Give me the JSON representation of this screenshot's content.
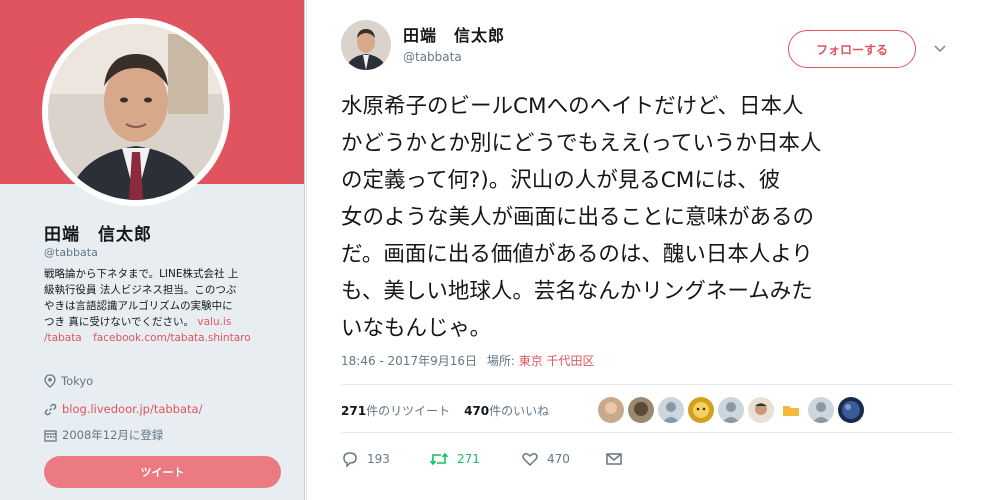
{
  "profile": {
    "name": "田端　信太郎",
    "handle": "@tabbata",
    "bio_lines": [
      "戦略論から下ネタまで。LINE株式会社 上",
      "級執行役員 法人ビジネス担当。このつぶ",
      "やきは言語認識アルゴリズムの実験中に",
      "つき 真に受けないでください。"
    ],
    "bio_link1_part": "valu.is",
    "bio_link1_rest": "/tabata",
    "bio_link2": "facebook.com/tabata.shintaro",
    "location": "Tokyo",
    "website": "blog.livedoor.jp/tabbata/",
    "joined": "2008年12月に登録",
    "tweet_button": "ツイート",
    "colors": {
      "banner": "#e0545f",
      "accent": "#e0545f"
    }
  },
  "tweet": {
    "name": "田端　信太郎",
    "handle": "@tabbata",
    "follow_button": "フォローする",
    "text": "水原希子のビールCMへのヘイトだけど、日本人\nかどうかとか別にどうでもええ(っていうか日本人\nの定義って何?)。沢山の人が見るCMには、彼\n女のような美人が画面に出ることに意味があるの\nだ。画面に出る価値があるのは、醜い日本人より\nも、美しい地球人。芸名なんかリングネームみた\nいなもんじゃ。",
    "timestamp": "18:46 - 2017年9月16日",
    "place_label": "場所:",
    "place": "東京 千代田区",
    "retweets_count": "271",
    "retweets_label": "件のリツイート",
    "likes_count": "470",
    "likes_label": "件のいいね",
    "actions": {
      "reply": "193",
      "retweet": "271",
      "like": "470"
    },
    "icons": [
      "reply-icon",
      "retweet-icon",
      "heart-icon",
      "message-icon",
      "chevron-down-icon",
      "location-icon",
      "link-icon",
      "calendar-icon"
    ]
  }
}
